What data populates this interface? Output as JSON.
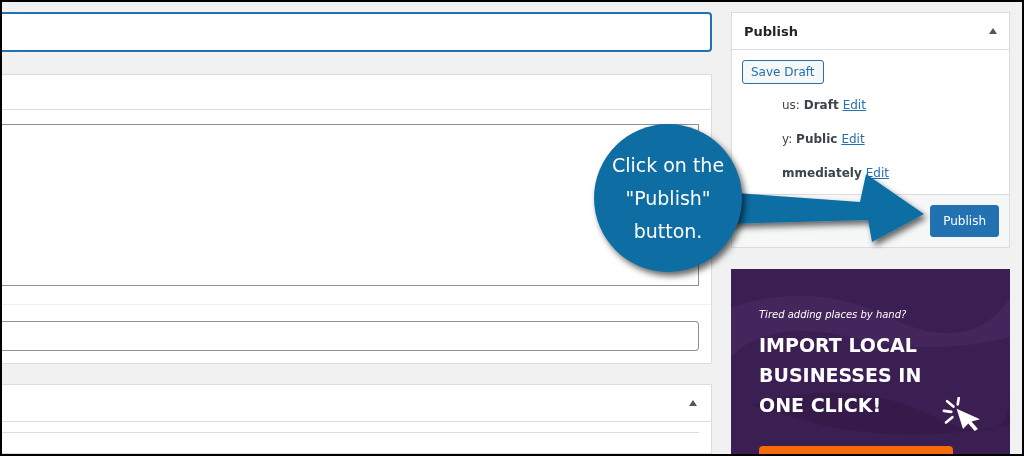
{
  "editor": {
    "meta_box": {
      "expanded": true
    }
  },
  "publish_box": {
    "title": "Publish",
    "expanded": true,
    "save_draft": "Save Draft",
    "rows": [
      {
        "label": "us:",
        "value": "Draft",
        "link": "Edit"
      },
      {
        "label": "y:",
        "value": "Public",
        "link": "Edit"
      },
      {
        "value": "mmediately",
        "link": "Edit"
      }
    ],
    "publish_button": "Publish"
  },
  "ad": {
    "tagline": "Tired adding places by hand?",
    "headline": "IMPORT LOCAL BUSINESSES IN ONE CLICK!"
  },
  "callout": {
    "text": "Click on the \"Publish\" button."
  }
}
